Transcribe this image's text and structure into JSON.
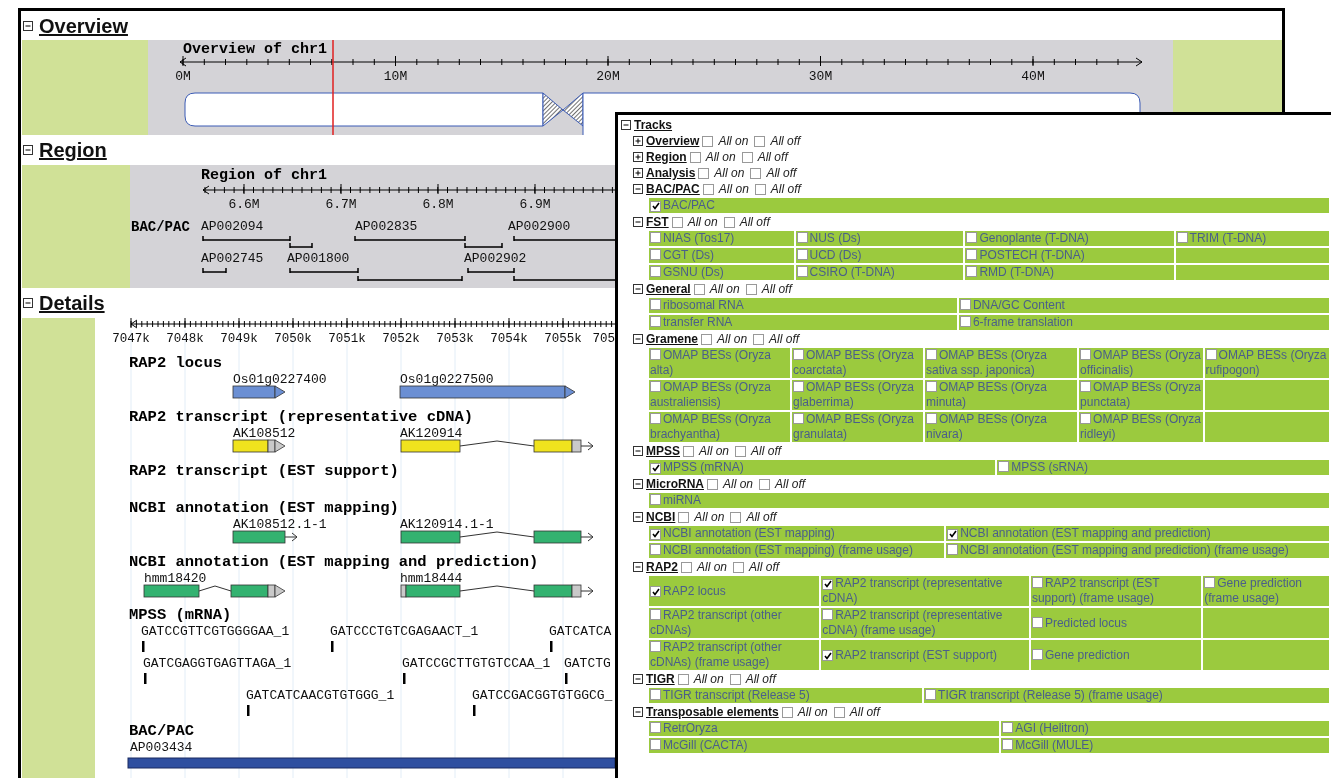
{
  "overview": {
    "heading": "Overview",
    "expanded": true,
    "title": "Overview of chr1",
    "ticks": [
      "0M",
      "10M",
      "20M",
      "30M",
      "40M"
    ]
  },
  "region": {
    "heading": "Region",
    "expanded": true,
    "title": "Region of chr1",
    "ticks": [
      "6.6M",
      "6.7M",
      "6.8M",
      "6.9M"
    ],
    "track_label": "BAC/PAC",
    "clones": [
      {
        "name": "AP002094"
      },
      {
        "name": "AP002835"
      },
      {
        "name": "AP002900"
      },
      {
        "name": "AP002745"
      },
      {
        "name": "AP001800"
      },
      {
        "name": "AP002902"
      }
    ]
  },
  "details": {
    "heading": "Details",
    "expanded": true,
    "ticks": [
      "7047k",
      "7048k",
      "7049k",
      "7050k",
      "7051k",
      "7052k",
      "7053k",
      "7054k",
      "7055k",
      "705"
    ],
    "tracks": [
      {
        "title": "RAP2 locus",
        "kind": "locus",
        "features": [
          {
            "name": "Os01g0227400"
          },
          {
            "name": "Os01g0227500"
          }
        ]
      },
      {
        "title": "RAP2 transcript (representative cDNA)",
        "kind": "transcript",
        "features": [
          {
            "name": "AK108512"
          },
          {
            "name": "AK120914"
          }
        ]
      },
      {
        "title": "RAP2 transcript (EST support)",
        "kind": "transcript"
      },
      {
        "title": "NCBI annotation (EST mapping)",
        "kind": "annotation",
        "features": [
          {
            "name": "AK108512.1-1"
          },
          {
            "name": "AK120914.1-1"
          }
        ]
      },
      {
        "title": "NCBI annotation (EST mapping and prediction)",
        "kind": "annotation",
        "features": [
          {
            "name": "hmm18420"
          },
          {
            "name": "hmm18444"
          }
        ]
      },
      {
        "title": "MPSS (mRNA)",
        "kind": "tag",
        "features": [
          {
            "name": "GATCCGTTCGTGGGGAA_1"
          },
          {
            "name": "GATCCCTGTCGAGAACT_1"
          },
          {
            "name": "GATCATCA"
          },
          {
            "name": "GATCGAGGTGAGTTAGA_1"
          },
          {
            "name": "GATCCGCTTGTGTCCAA_1"
          },
          {
            "name": "GATCTG"
          },
          {
            "name": "GATCATCAACGTGTGGG_1"
          },
          {
            "name": "GATCCGACGGTGTGGCG_"
          }
        ]
      },
      {
        "title": "BAC/PAC",
        "kind": "clone",
        "features": [
          {
            "name": "AP003434"
          }
        ]
      }
    ]
  },
  "tracks_panel": {
    "title": "Tracks",
    "expanded": true,
    "groups": [
      {
        "name": "Overview",
        "expanded": false,
        "all_on": {
          "label": "All on",
          "checked": false
        },
        "all_off": {
          "label": "All off",
          "checked": false
        }
      },
      {
        "name": "Region",
        "expanded": false,
        "all_on": {
          "label": "All on",
          "checked": false
        },
        "all_off": {
          "label": "All off",
          "checked": false
        }
      },
      {
        "name": "Analysis",
        "expanded": false,
        "all_on": {
          "label": "All on",
          "checked": false
        },
        "all_off": {
          "label": "All off",
          "checked": false
        }
      },
      {
        "name": "BAC/PAC",
        "expanded": true,
        "all_on": {
          "label": "All on",
          "checked": false
        },
        "all_off": {
          "label": "All off",
          "checked": false
        },
        "rows": [
          [
            {
              "label": "BAC/PAC",
              "checked": true
            }
          ]
        ]
      },
      {
        "name": "FST",
        "expanded": true,
        "all_on": {
          "label": "All on",
          "checked": false
        },
        "all_off": {
          "label": "All off",
          "checked": false
        },
        "rows": [
          [
            {
              "label": "NIAS (Tos17)",
              "checked": false
            },
            {
              "label": "NUS (Ds)",
              "checked": false
            },
            {
              "label": "Genoplante (T-DNA)",
              "checked": false
            },
            {
              "label": "TRIM (T-DNA)",
              "checked": false
            }
          ],
          [
            {
              "label": "CGT (Ds)",
              "checked": false
            },
            {
              "label": "UCD (Ds)",
              "checked": false
            },
            {
              "label": "POSTECH (T-DNA)",
              "checked": false
            }
          ],
          [
            {
              "label": "GSNU (Ds)",
              "checked": false
            },
            {
              "label": "CSIRO (T-DNA)",
              "checked": false
            },
            {
              "label": "RMD (T-DNA)",
              "checked": false
            }
          ]
        ]
      },
      {
        "name": "General",
        "expanded": true,
        "all_on": {
          "label": "All on",
          "checked": false
        },
        "all_off": {
          "label": "All off",
          "checked": false
        },
        "rows": [
          [
            {
              "label": "ribosomal RNA",
              "checked": false
            },
            {
              "label": "DNA/GC Content",
              "checked": false
            }
          ],
          [
            {
              "label": "transfer RNA",
              "checked": false
            },
            {
              "label": "6-frame translation",
              "checked": false
            }
          ]
        ]
      },
      {
        "name": "Gramene",
        "expanded": true,
        "all_on": {
          "label": "All on",
          "checked": false
        },
        "all_off": {
          "label": "All off",
          "checked": false
        },
        "rows": [
          [
            {
              "label": "OMAP BESs (Oryza alta)",
              "checked": false
            },
            {
              "label": "OMAP BESs (Oryza coarctata)",
              "checked": false
            },
            {
              "label": "OMAP BESs (Oryza sativa ssp. japonica)",
              "checked": false
            },
            {
              "label": "OMAP BESs (Oryza officinalis)",
              "checked": false
            },
            {
              "label": "OMAP BESs (Oryza rufipogon)",
              "checked": false
            }
          ],
          [
            {
              "label": "OMAP BESs (Oryza australiensis)",
              "checked": false
            },
            {
              "label": "OMAP BESs (Oryza glaberrima)",
              "checked": false
            },
            {
              "label": "OMAP BESs (Oryza minuta)",
              "checked": false
            },
            {
              "label": "OMAP BESs (Oryza punctata)",
              "checked": false
            }
          ],
          [
            {
              "label": "OMAP BESs (Oryza brachyantha)",
              "checked": false
            },
            {
              "label": "OMAP BESs (Oryza granulata)",
              "checked": false
            },
            {
              "label": "OMAP BESs (Oryza nivara)",
              "checked": false
            },
            {
              "label": "OMAP BESs (Oryza ridleyi)",
              "checked": false
            }
          ]
        ]
      },
      {
        "name": "MPSS",
        "expanded": true,
        "all_on": {
          "label": "All on",
          "checked": false
        },
        "all_off": {
          "label": "All off",
          "checked": false
        },
        "rows": [
          [
            {
              "label": "MPSS (mRNA)",
              "checked": true
            },
            {
              "label": "MPSS (sRNA)",
              "checked": false
            }
          ]
        ]
      },
      {
        "name": "MicroRNA",
        "expanded": true,
        "all_on": {
          "label": "All on",
          "checked": false
        },
        "all_off": {
          "label": "All off",
          "checked": false
        },
        "rows": [
          [
            {
              "label": "miRNA",
              "checked": false
            }
          ]
        ]
      },
      {
        "name": "NCBI",
        "expanded": true,
        "all_on": {
          "label": "All on",
          "checked": false
        },
        "all_off": {
          "label": "All off",
          "checked": false
        },
        "rows": [
          [
            {
              "label": "NCBI annotation (EST mapping)",
              "checked": true
            },
            {
              "label": "NCBI annotation (EST mapping and prediction)",
              "checked": true
            }
          ],
          [
            {
              "label": "NCBI annotation (EST mapping) (frame usage)",
              "checked": false
            },
            {
              "label": "NCBI annotation (EST mapping and prediction) (frame usage)",
              "checked": false
            }
          ]
        ]
      },
      {
        "name": "RAP2",
        "expanded": true,
        "all_on": {
          "label": "All on",
          "checked": false
        },
        "all_off": {
          "label": "All off",
          "checked": false
        },
        "rows": [
          [
            {
              "label": "RAP2 locus",
              "checked": true
            },
            {
              "label": "RAP2 transcript (representative cDNA)",
              "checked": true
            },
            {
              "label": "RAP2 transcript (EST support) (frame usage)",
              "checked": false
            },
            {
              "label": "Gene prediction (frame usage)",
              "checked": false
            }
          ],
          [
            {
              "label": "RAP2 transcript (other cDNAs)",
              "checked": false
            },
            {
              "label": "RAP2 transcript (representative cDNA) (frame usage)",
              "checked": false
            },
            {
              "label": "Predicted locus",
              "checked": false
            }
          ],
          [
            {
              "label": "RAP2 transcript (other cDNAs) (frame usage)",
              "checked": false
            },
            {
              "label": "RAP2 transcript (EST support)",
              "checked": true
            },
            {
              "label": "Gene prediction",
              "checked": false
            }
          ]
        ]
      },
      {
        "name": "TIGR",
        "expanded": true,
        "all_on": {
          "label": "All on",
          "checked": false
        },
        "all_off": {
          "label": "All off",
          "checked": false
        },
        "rows": [
          [
            {
              "label": "TIGR transcript (Release 5)",
              "checked": false
            },
            {
              "label": "TIGR transcript (Release 5) (frame usage)",
              "checked": false
            }
          ]
        ]
      },
      {
        "name": "Transposable elements",
        "expanded": true,
        "all_on": {
          "label": "All on",
          "checked": false
        },
        "all_off": {
          "label": "All off",
          "checked": false
        },
        "rows": [
          [
            {
              "label": "RetrOryza",
              "checked": false
            },
            {
              "label": "AGI (Helitron)",
              "checked": false
            }
          ],
          [
            {
              "label": "McGill (CACTA)",
              "checked": false
            },
            {
              "label": "McGill (MULE)",
              "checked": false
            }
          ]
        ]
      }
    ]
  }
}
